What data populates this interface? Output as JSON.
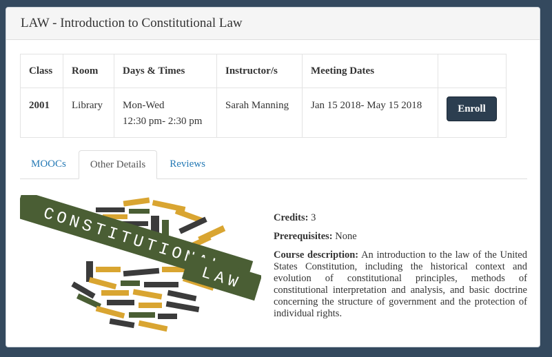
{
  "panel": {
    "title": "LAW - Introduction to Constitutional Law"
  },
  "schedule": {
    "headers": {
      "class": "Class",
      "room": "Room",
      "days": "Days & Times",
      "instructor": "Instructor/s",
      "dates": "Meeting Dates"
    },
    "row": {
      "class": "2001",
      "room": "Library",
      "days_line1": "Mon-Wed",
      "days_line2": "12:30 pm- 2:30 pm",
      "instructor": "Sarah Manning",
      "dates": "Jan 15 2018- May 15 2018",
      "enroll_label": "Enroll"
    }
  },
  "tabs": [
    {
      "label": "MOOCs",
      "active": false
    },
    {
      "label": "Other Details",
      "active": true
    },
    {
      "label": "Reviews",
      "active": false
    }
  ],
  "image": {
    "word1": "CONSTITUTIONAL",
    "word2": "LAW"
  },
  "details": {
    "credits_label": "Credits:",
    "credits_value": "3",
    "prereq_label": "Prerequisites:",
    "prereq_value": "None",
    "desc_label": "Course description:",
    "desc_value": "An introduction to the law of the United States Constitution, including the historical context and evolution of constitutional principles, methods of constitutional interpretation and analysis, and basic doctrine concerning the structure of government and the protection of individual rights."
  },
  "colors": {
    "background": "#34495e",
    "enroll_button": "#2c3e50",
    "link": "#2479b5",
    "cloud_green": "#4a5e34",
    "cloud_gold": "#d9a531"
  }
}
